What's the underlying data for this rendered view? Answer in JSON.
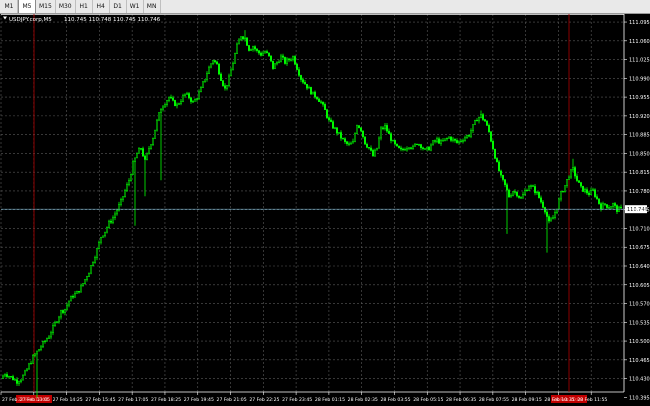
{
  "timeframes": [
    {
      "label": "M1",
      "active": false
    },
    {
      "label": "M5",
      "active": true
    },
    {
      "label": "M15",
      "active": false
    },
    {
      "label": "M30",
      "active": false
    },
    {
      "label": "H1",
      "active": false
    },
    {
      "label": "H4",
      "active": false
    },
    {
      "label": "D1",
      "active": false
    },
    {
      "label": "W1",
      "active": false
    },
    {
      "label": "MN",
      "active": false
    }
  ],
  "header": {
    "symbol": "USDJPY.corp,M5",
    "quote": "110.745 110.748 110.745 110.746"
  },
  "current_price": "110.746",
  "colors": {
    "background": "#000000",
    "candle": "#00ff00",
    "grid": "#5a5a5a",
    "price_line": "#6fa9c4",
    "session_line": "#b00000",
    "axis_text": "#ffffff"
  },
  "chart_data": {
    "type": "candlestick",
    "ylim": [
      110.405,
      111.11
    ],
    "y_ticks": [
      111.095,
      111.06,
      111.025,
      110.99,
      110.955,
      110.92,
      110.885,
      110.85,
      110.815,
      110.78,
      110.745,
      110.71,
      110.675,
      110.64,
      110.605,
      110.57,
      110.535,
      110.5,
      110.465,
      110.43,
      110.395
    ],
    "y_tick_labels": [
      "111.095",
      "111.060",
      "111.025",
      "110.990",
      "110.955",
      "110.920",
      "110.885",
      "110.850",
      "110.815",
      "110.780",
      "110.745",
      "110.710",
      "110.675",
      "110.640",
      "110.605",
      "110.570",
      "110.535",
      "110.500",
      "110.465",
      "110.430",
      "110.395"
    ],
    "x_tick_labels": [
      "27 Feb",
      "27 Feb 13:05",
      "27 Feb 14:25",
      "27 Feb 15:45",
      "27 Feb 17:05",
      "27 Feb 18:25",
      "27 Feb 19:45",
      "27 Feb 21:05",
      "27 Feb 22:25",
      "27 Feb 23:45",
      "28 Feb 01:15",
      "28 Feb 02:35",
      "28 Feb 03:55",
      "28 Feb 05:15",
      "28 Feb 06:35",
      "28 Feb 07:55",
      "28 Feb 09:15",
      "28 Feb 10:35",
      "28 Feb 11:55"
    ],
    "highlighted_x_labels": [
      "27 Feb 12:00",
      "28 Feb 10:00"
    ],
    "current_price": 110.746,
    "close_path": [
      [
        0,
        110.43
      ],
      [
        4,
        110.44
      ],
      [
        8,
        110.435
      ],
      [
        12,
        110.43
      ],
      [
        16,
        110.425
      ],
      [
        20,
        110.43
      ],
      [
        24,
        110.44
      ],
      [
        28,
        110.455
      ],
      [
        32,
        110.47
      ],
      [
        36,
        110.48
      ],
      [
        40,
        110.49
      ],
      [
        44,
        110.5
      ],
      [
        48,
        110.51
      ],
      [
        52,
        110.525
      ],
      [
        56,
        110.54
      ],
      [
        60,
        110.555
      ],
      [
        64,
        110.56
      ],
      [
        68,
        110.575
      ],
      [
        72,
        110.585
      ],
      [
        76,
        110.59
      ],
      [
        80,
        110.6
      ],
      [
        84,
        110.615
      ],
      [
        88,
        110.63
      ],
      [
        92,
        110.65
      ],
      [
        96,
        110.67
      ],
      [
        100,
        110.695
      ],
      [
        104,
        110.705
      ],
      [
        108,
        110.72
      ],
      [
        112,
        110.73
      ],
      [
        116,
        110.745
      ],
      [
        120,
        110.76
      ],
      [
        124,
        110.78
      ],
      [
        128,
        110.8
      ],
      [
        132,
        110.83
      ],
      [
        136,
        110.85
      ],
      [
        140,
        110.86
      ],
      [
        144,
        110.835
      ],
      [
        148,
        110.86
      ],
      [
        152,
        110.88
      ],
      [
        156,
        110.91
      ],
      [
        160,
        110.935
      ],
      [
        164,
        110.945
      ],
      [
        168,
        110.955
      ],
      [
        172,
        110.945
      ],
      [
        176,
        110.94
      ],
      [
        180,
        110.95
      ],
      [
        184,
        110.96
      ],
      [
        188,
        110.955
      ],
      [
        192,
        110.945
      ],
      [
        196,
        110.955
      ],
      [
        200,
        110.97
      ],
      [
        204,
        110.99
      ],
      [
        208,
        111.01
      ],
      [
        212,
        111.025
      ],
      [
        216,
        111.015
      ],
      [
        220,
        110.99
      ],
      [
        224,
        110.97
      ],
      [
        228,
        110.99
      ],
      [
        232,
        111.02
      ],
      [
        236,
        111.05
      ],
      [
        240,
        111.07
      ],
      [
        244,
        111.065
      ],
      [
        248,
        111.045
      ],
      [
        252,
        111.05
      ],
      [
        256,
        111.04
      ],
      [
        260,
        111.035
      ],
      [
        264,
        111.04
      ],
      [
        268,
        111.03
      ],
      [
        272,
        111.01
      ],
      [
        276,
        111.02
      ],
      [
        280,
        111.03
      ],
      [
        284,
        111.02
      ],
      [
        288,
        111.025
      ],
      [
        292,
        111.03
      ],
      [
        296,
        111.01
      ],
      [
        300,
        110.99
      ],
      [
        304,
        110.98
      ],
      [
        308,
        110.97
      ],
      [
        312,
        110.96
      ],
      [
        316,
        110.955
      ],
      [
        320,
        110.945
      ],
      [
        324,
        110.93
      ],
      [
        328,
        110.91
      ],
      [
        332,
        110.9
      ],
      [
        336,
        110.89
      ],
      [
        340,
        110.88
      ],
      [
        344,
        110.87
      ],
      [
        348,
        110.865
      ],
      [
        352,
        110.87
      ],
      [
        356,
        110.905
      ],
      [
        360,
        110.895
      ],
      [
        364,
        110.87
      ],
      [
        368,
        110.86
      ],
      [
        372,
        110.845
      ],
      [
        376,
        110.86
      ],
      [
        380,
        110.895
      ],
      [
        384,
        110.9
      ],
      [
        388,
        110.885
      ],
      [
        392,
        110.87
      ],
      [
        396,
        110.86
      ],
      [
        400,
        110.855
      ],
      [
        404,
        110.86
      ],
      [
        408,
        110.865
      ],
      [
        412,
        110.86
      ],
      [
        416,
        110.87
      ],
      [
        420,
        110.865
      ],
      [
        424,
        110.855
      ],
      [
        428,
        110.86
      ],
      [
        432,
        110.87
      ],
      [
        436,
        110.875
      ],
      [
        440,
        110.87
      ],
      [
        444,
        110.875
      ],
      [
        448,
        110.88
      ],
      [
        452,
        110.875
      ],
      [
        456,
        110.87
      ],
      [
        460,
        110.875
      ],
      [
        464,
        110.88
      ],
      [
        468,
        110.885
      ],
      [
        472,
        110.9
      ],
      [
        476,
        110.915
      ],
      [
        480,
        110.92
      ],
      [
        484,
        110.91
      ],
      [
        488,
        110.89
      ],
      [
        492,
        110.86
      ],
      [
        496,
        110.83
      ],
      [
        500,
        110.805
      ],
      [
        504,
        110.79
      ],
      [
        508,
        110.77
      ],
      [
        512,
        110.78
      ],
      [
        516,
        110.775
      ],
      [
        520,
        110.765
      ],
      [
        524,
        110.78
      ],
      [
        528,
        110.79
      ],
      [
        532,
        110.785
      ],
      [
        536,
        110.775
      ],
      [
        540,
        110.76
      ],
      [
        544,
        110.745
      ],
      [
        548,
        110.72
      ],
      [
        552,
        110.73
      ],
      [
        556,
        110.75
      ],
      [
        560,
        110.775
      ],
      [
        564,
        110.79
      ],
      [
        568,
        110.81
      ],
      [
        572,
        110.82
      ],
      [
        576,
        110.8
      ],
      [
        580,
        110.785
      ],
      [
        584,
        110.78
      ],
      [
        588,
        110.775
      ],
      [
        592,
        110.78
      ],
      [
        596,
        110.765
      ],
      [
        600,
        110.75
      ],
      [
        604,
        110.755
      ],
      [
        608,
        110.75
      ],
      [
        612,
        110.755
      ],
      [
        616,
        110.745
      ],
      [
        620,
        110.746
      ]
    ],
    "spikes": [
      {
        "x": 36,
        "low": 110.395
      },
      {
        "x": 134,
        "low": 110.715
      },
      {
        "x": 144,
        "low": 110.77
      },
      {
        "x": 160,
        "low": 110.8
      },
      {
        "x": 244,
        "high": 111.08
      },
      {
        "x": 480,
        "high": 110.93
      },
      {
        "x": 506,
        "low": 110.7
      },
      {
        "x": 546,
        "low": 110.665
      },
      {
        "x": 572,
        "high": 110.84
      }
    ]
  }
}
